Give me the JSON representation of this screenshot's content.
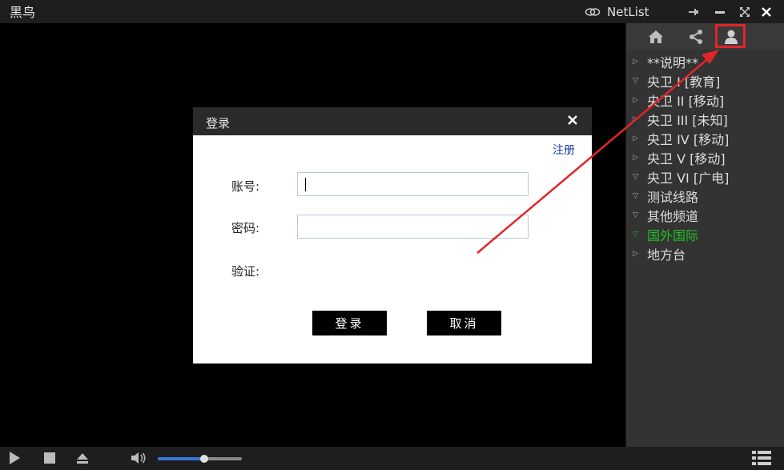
{
  "app": {
    "title": "黑鸟",
    "netlist_label": "NetList"
  },
  "window_controls": {
    "pin": "pin-icon",
    "minimize": "minimize-icon",
    "maximize": "maximize-icon",
    "close": "close-icon"
  },
  "sidebar": {
    "tabs": [
      {
        "icon": "home-icon"
      },
      {
        "icon": "share-icon"
      },
      {
        "icon": "user-icon",
        "highlighted": true
      }
    ],
    "items": [
      {
        "label": "**说明**",
        "expanded": false
      },
      {
        "label": "央卫 I [教育]",
        "expanded": true
      },
      {
        "label": "央卫 II [移动]",
        "expanded": false
      },
      {
        "label": "央卫 III [未知]",
        "expanded": false
      },
      {
        "label": "央卫 IV [移动]",
        "expanded": false
      },
      {
        "label": "央卫 V [移动]",
        "expanded": false
      },
      {
        "label": "央卫 VI [广电]",
        "expanded": true
      },
      {
        "label": "测试线路",
        "expanded": true
      },
      {
        "label": "其他频道",
        "expanded": true
      },
      {
        "label": "国外国际",
        "expanded": true,
        "active": true
      },
      {
        "label": "地方台",
        "expanded": false
      }
    ]
  },
  "login_dialog": {
    "title": "登录",
    "register_link": "注册",
    "account_label": "账号:",
    "account_value": "",
    "password_label": "密码:",
    "password_value": "",
    "verify_label": "验证:",
    "login_button": "登录",
    "cancel_button": "取消"
  },
  "controls": {
    "volume_level": 0.55
  },
  "colors": {
    "accent_active": "#22c322",
    "highlight_box": "#e0262a",
    "volume_fill": "#3a78d8",
    "link": "#1a3fa8"
  }
}
